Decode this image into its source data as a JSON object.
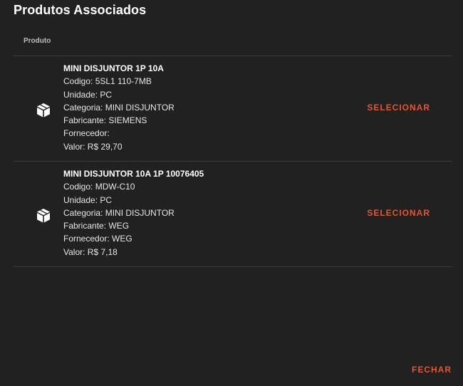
{
  "dialog": {
    "title": "Produtos Associados",
    "close_label": "FECHAR"
  },
  "table": {
    "column_header": "Produto",
    "rows": [
      {
        "icon": "box-icon",
        "name": "MINI DISJUNTOR 1P 10A",
        "codigo": "Codigo: 5SL1 110-7MB",
        "unidade": "Unidade: PC",
        "categoria": "Categoria: MINI DISJUNTOR",
        "fabricante": "Fabricante: SIEMENS",
        "fornecedor": "Fornecedor:",
        "valor": "Valor: R$ 29,70",
        "action_label": "SELECIONAR"
      },
      {
        "icon": "box-icon",
        "name": "MINI DISJUNTOR 10A 1P 10076405",
        "codigo": "Codigo: MDW-C10",
        "unidade": "Unidade: PC",
        "categoria": "Categoria: MINI DISJUNTOR",
        "fabricante": "Fabricante: WEG",
        "fornecedor": "Fornecedor: WEG",
        "valor": "Valor: R$ 7,18",
        "action_label": "SELECIONAR"
      }
    ]
  },
  "colors": {
    "background": "#212121",
    "accent": "#e4572e",
    "divider": "#3c3c3c"
  }
}
